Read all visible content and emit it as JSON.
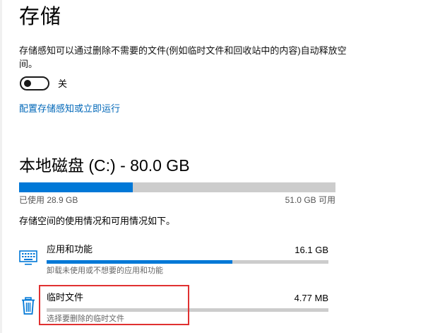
{
  "page": {
    "title": "存储"
  },
  "storage_sense": {
    "description": "存储感知可以通过删除不需要的文件(例如临时文件和回收站中的内容)自动释放空间。",
    "toggle_label": "关",
    "toggle_on": false,
    "configure_link": "配置存储感知或立即运行"
  },
  "drive": {
    "title": "本地磁盘 (C:) - 80.0 GB",
    "used_label": "已使用 28.9 GB",
    "available_label": "51.0 GB 可用",
    "used_fraction": 0.36,
    "usage_intro": "存储空间的使用情况和可用情况如下。"
  },
  "categories": [
    {
      "name": "应用和功能",
      "size": "16.1 GB",
      "subtitle": "卸载未使用或不想要的应用和功能",
      "fraction": 0.66,
      "icon": "apps-icon"
    },
    {
      "name": "临时文件",
      "size": "4.77 MB",
      "subtitle": "选择要删除的临时文件",
      "fraction": 0.0,
      "icon": "trash-icon"
    }
  ],
  "colors": {
    "accent": "#0078d7",
    "link": "#0067b8",
    "bar_track": "#cccccc",
    "highlight": "#e03131"
  }
}
